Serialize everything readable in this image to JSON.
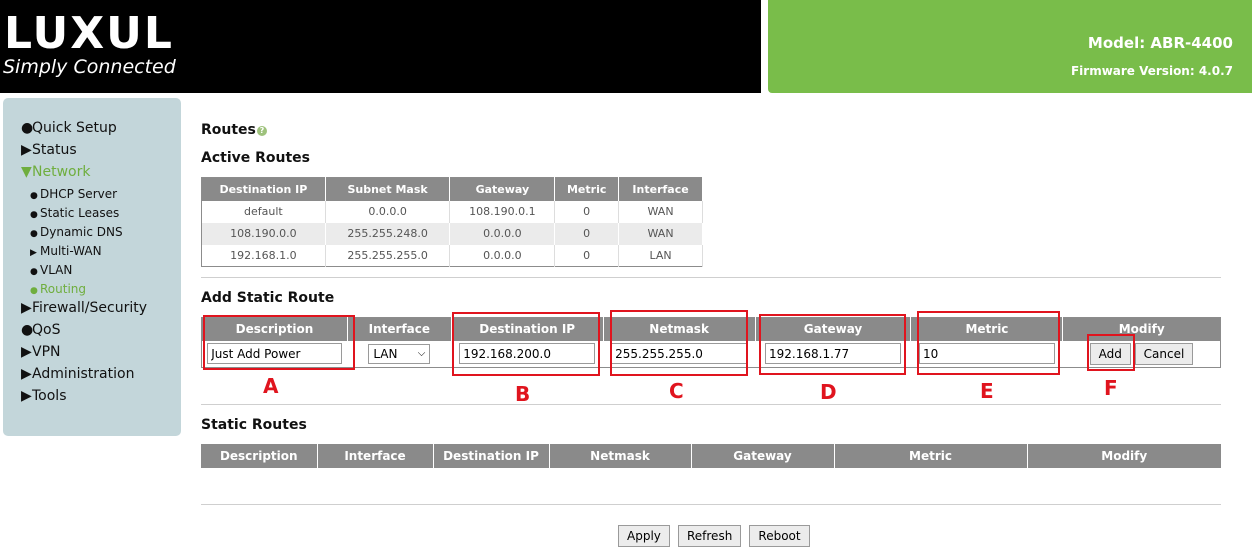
{
  "header": {
    "logo": "LUXUL",
    "tagline": "Simply Connected",
    "model": "Model: ABR-4400",
    "firmware": "Firmware Version: 4.0.7"
  },
  "sidebar": {
    "items": [
      {
        "label": "Quick Setup",
        "bullet": "●",
        "level": 1
      },
      {
        "label": "Status",
        "bullet": "▶",
        "level": 1
      },
      {
        "label": "Network",
        "bullet": "▼",
        "level": 1,
        "active": true
      },
      {
        "label": "DHCP Server",
        "bullet": "●",
        "level": 2
      },
      {
        "label": "Static Leases",
        "bullet": "●",
        "level": 2
      },
      {
        "label": "Dynamic DNS",
        "bullet": "●",
        "level": 2
      },
      {
        "label": "Multi-WAN",
        "bullet": "▶",
        "level": 2
      },
      {
        "label": "VLAN",
        "bullet": "●",
        "level": 2
      },
      {
        "label": "Routing",
        "bullet": "●",
        "level": 2,
        "active": true
      },
      {
        "label": "Firewall/Security",
        "bullet": "▶",
        "level": 1
      },
      {
        "label": "QoS",
        "bullet": "●",
        "level": 1
      },
      {
        "label": "VPN",
        "bullet": "▶",
        "level": 1
      },
      {
        "label": "Administration",
        "bullet": "▶",
        "level": 1
      },
      {
        "label": "Tools",
        "bullet": "▶",
        "level": 1
      }
    ]
  },
  "routes": {
    "title": "Routes",
    "help_icon": "?",
    "active_title": "Active Routes",
    "active_columns": [
      "Destination IP",
      "Subnet Mask",
      "Gateway",
      "Metric",
      "Interface"
    ],
    "active_rows": [
      [
        "default",
        "0.0.0.0",
        "108.190.0.1",
        "0",
        "WAN"
      ],
      [
        "108.190.0.0",
        "255.255.248.0",
        "0.0.0.0",
        "0",
        "WAN"
      ],
      [
        "192.168.1.0",
        "255.255.255.0",
        "0.0.0.0",
        "0",
        "LAN"
      ]
    ]
  },
  "add_route": {
    "title": "Add Static Route",
    "columns": [
      "Description",
      "Interface",
      "Destination IP",
      "Netmask",
      "Gateway",
      "Metric",
      "Modify"
    ],
    "description": "Just Add Power",
    "interface": "LAN",
    "destination_ip": "192.168.200.0",
    "netmask": "255.255.255.0",
    "gateway": "192.168.1.77",
    "metric": "10",
    "add_label": "Add",
    "cancel_label": "Cancel",
    "markers": [
      "A",
      "B",
      "C",
      "D",
      "E",
      "F"
    ],
    "marker_color": "#e0141e"
  },
  "static_routes": {
    "title": "Static Routes",
    "columns": [
      "Description",
      "Interface",
      "Destination IP",
      "Netmask",
      "Gateway",
      "Metric",
      "Modify"
    ]
  },
  "footer": {
    "apply_label": "Apply",
    "refresh_label": "Refresh",
    "reboot_label": "Reboot"
  },
  "colors": {
    "brand_green": "#79bd4a",
    "active_nav": "#6fae3e",
    "sidebar_bg": "#c3d6da",
    "table_header": "#8a8a8a"
  }
}
